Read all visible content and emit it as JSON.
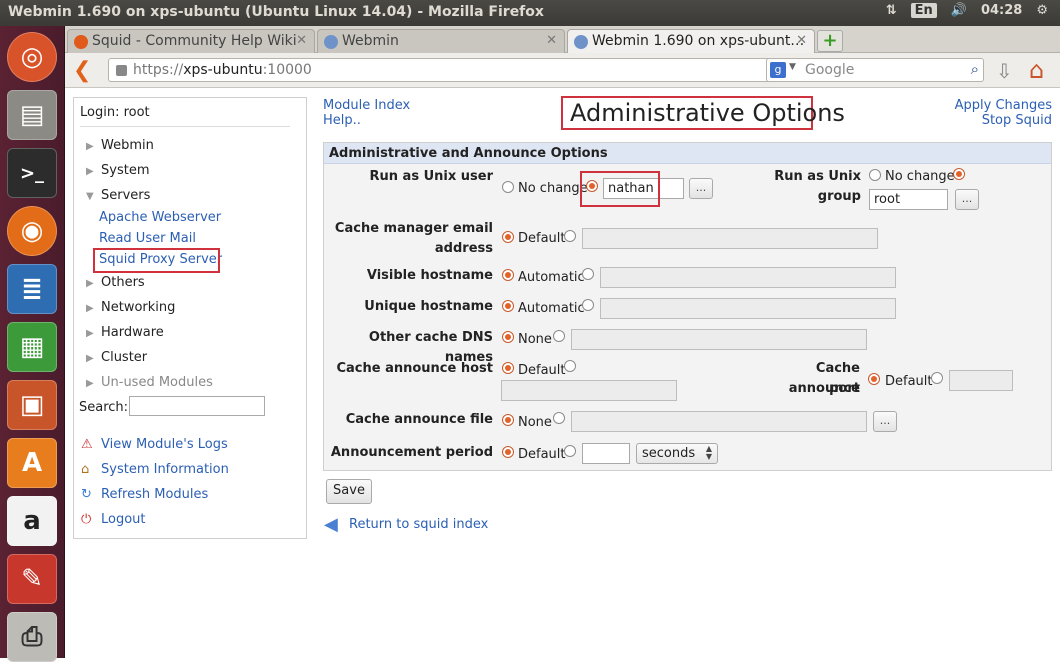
{
  "os": {
    "window_title": "Webmin 1.690 on xps-ubuntu (Ubuntu Linux 14.04) - Mozilla Firefox",
    "lang": "En",
    "time": "04:28"
  },
  "browser": {
    "tabs": [
      {
        "label": "Squid - Community Help Wiki",
        "close": "✕"
      },
      {
        "label": "Webmin",
        "close": "✕"
      },
      {
        "label": "Webmin 1.690 on xps-ubunt…",
        "close": "✕"
      }
    ],
    "url_prefix": "https://",
    "url_host": "xps-ubuntu",
    "url_port": ":10000",
    "search_placeholder": "Google"
  },
  "sidebar": {
    "login": "Login: root",
    "categories": [
      "Webmin",
      "System",
      "Servers",
      "Others",
      "Networking",
      "Hardware",
      "Cluster",
      "Un-used Modules"
    ],
    "server_modules": [
      "Apache Webserver",
      "Read User Mail",
      "Squid Proxy Server"
    ],
    "search_label": "Search:",
    "links": [
      "View Module's Logs",
      "System Information",
      "Refresh Modules",
      "Logout"
    ]
  },
  "header": {
    "module_index": "Module Index",
    "help": "Help..",
    "title": "Administrative Options",
    "apply_changes": "Apply Changes",
    "stop_squid": "Stop Squid"
  },
  "options": {
    "section_title": "Administrative and Announce Options",
    "unix_user": {
      "label": "Run as Unix user",
      "no_change": "No change",
      "value": "nathan",
      "dots": "..."
    },
    "unix_group": {
      "label_1": "Run as Unix",
      "label_2": "group",
      "no_change": "No change",
      "value": "root",
      "dots": "..."
    },
    "cache_email": {
      "label_1": "Cache manager email",
      "label_2": "address",
      "default": "Default"
    },
    "visible_host": {
      "label": "Visible hostname",
      "automatic": "Automatic"
    },
    "unique_host": {
      "label": "Unique hostname",
      "automatic": "Automatic"
    },
    "dns_names": {
      "label": "Other cache DNS names",
      "none": "None"
    },
    "announce_host": {
      "label": "Cache announce host",
      "default": "Default"
    },
    "announce_port": {
      "label_1": "Cache announce",
      "label_2": "port",
      "default": "Default"
    },
    "announce_file": {
      "label": "Cache announce file",
      "none": "None",
      "dots": "..."
    },
    "announce_period": {
      "label": "Announcement period",
      "default": "Default",
      "unit": "seconds"
    }
  },
  "footer": {
    "save": "Save",
    "return": "Return to squid index"
  }
}
